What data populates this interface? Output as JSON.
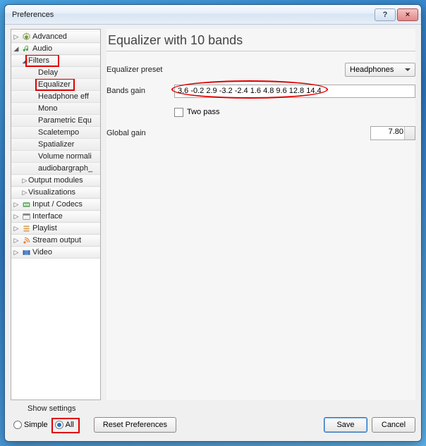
{
  "window": {
    "title": "Preferences",
    "help": "?",
    "close": "×"
  },
  "tree": {
    "advanced": "Advanced",
    "audio": "Audio",
    "filters": "Filters",
    "delay": "Delay",
    "equalizer": "Equalizer",
    "headphone": "Headphone eff",
    "mono": "Mono",
    "parametric": "Parametric Equ",
    "scaletempo": "Scaletempo",
    "spatializer": "Spatializer",
    "volnorm": "Volume normali",
    "audiobar": "audiobargraph_",
    "output": "Output modules",
    "viz": "Visualizations",
    "input": "Input / Codecs",
    "interface": "Interface",
    "playlist": "Playlist",
    "stream": "Stream output",
    "video": "Video"
  },
  "main": {
    "heading": "Equalizer with 10 bands",
    "preset_label": "Equalizer preset",
    "preset_value": "Headphones",
    "bands_label": "Bands gain",
    "bands_value": "3.6 -0.2 2.9 -3.2 -2.4 1.6 4.8 9.6 12.8 14.4",
    "twopass_label": "Two pass",
    "global_label": "Global gain",
    "global_value": "7.80"
  },
  "footer": {
    "show_label": "Show settings",
    "simple": "Simple",
    "all": "All",
    "reset": "Reset Preferences",
    "save": "Save",
    "cancel": "Cancel"
  }
}
